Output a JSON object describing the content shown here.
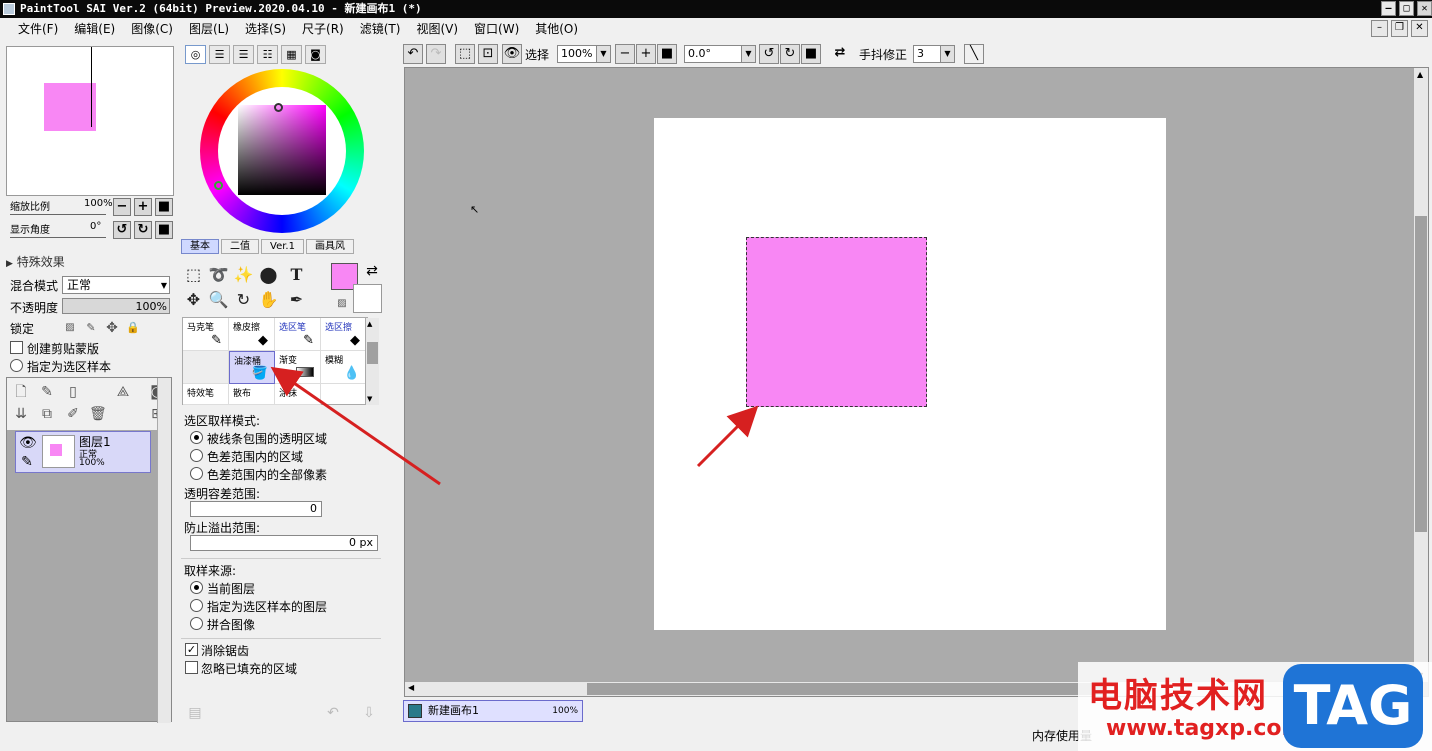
{
  "window": {
    "title": "PaintTool SAI Ver.2 (64bit) Preview.2020.04.10 - 新建画布1 (*)"
  },
  "menu": [
    "文件(F)",
    "编辑(E)",
    "图像(C)",
    "图层(L)",
    "选择(S)",
    "尺子(R)",
    "滤镜(T)",
    "视图(V)",
    "窗口(W)",
    "其他(O)"
  ],
  "navigator": {
    "zoom_label": "缩放比例",
    "zoom_value": "100%",
    "angle_label": "显示角度",
    "angle_value": "0°"
  },
  "layer_props": {
    "effects_label": "特殊效果",
    "blend_label": "混合模式",
    "blend_value": "正常",
    "opacity_label": "不透明度",
    "opacity_value": "100%",
    "lock_label": "锁定",
    "clip_label": "创建剪贴蒙版",
    "sample_label": "指定为选区样本"
  },
  "layer": {
    "name": "图层1",
    "mode": "正常",
    "opacity": "100%"
  },
  "color_tabs": [
    "基本",
    "二值",
    "Ver.1",
    "画具风"
  ],
  "colors": {
    "primary": "#f887f4",
    "secondary": "#ffffff"
  },
  "tools": [
    {
      "name": "马克笔",
      "icon": "pen"
    },
    {
      "name": "橡皮擦",
      "icon": "eraser"
    },
    {
      "name": "选区笔",
      "icon": "select-pen"
    },
    {
      "name": "选区擦",
      "icon": "select-eraser"
    },
    {
      "name": "",
      "icon": ""
    },
    {
      "name": "油漆桶",
      "icon": "bucket"
    },
    {
      "name": "渐变",
      "icon": "gradient"
    },
    {
      "name": "模糊",
      "icon": "blur"
    },
    {
      "name": "特效笔",
      "icon": ""
    },
    {
      "name": "散布",
      "icon": ""
    },
    {
      "name": "涂抹",
      "icon": ""
    }
  ],
  "fill_options": {
    "mode_label": "选区取样模式:",
    "mode_options": [
      "被线条包围的透明区域",
      "色差范围内的区域",
      "色差范围内的全部像素"
    ],
    "tolerance_label": "透明容差范围:",
    "tolerance_value": "0",
    "overflow_label": "防止溢出范围:",
    "overflow_value": "0 px",
    "source_label": "取样来源:",
    "source_options": [
      "当前图层",
      "指定为选区样本的图层",
      "拼合图像"
    ],
    "antialias_label": "消除锯齿",
    "ignore_label": "忽略已填充的区域"
  },
  "toolbar": {
    "select_label": "选择",
    "zoom_value": "100%",
    "angle_value": "0.0°",
    "stabilizer_label": "手抖修正",
    "stabilizer_value": "3"
  },
  "document": {
    "name": "新建画布1",
    "zoom": "100%"
  },
  "status": {
    "memory_label": "内存使用量"
  },
  "watermark": {
    "title": "电脑技术网",
    "url": "www.tagxp.com",
    "logo": "TAG"
  }
}
